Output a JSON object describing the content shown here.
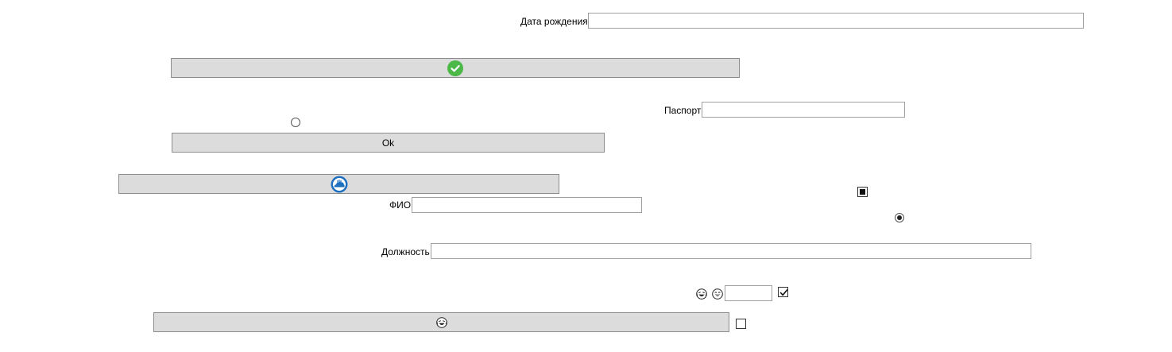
{
  "form": {
    "birth_date": {
      "label": "Дата рождения",
      "value": ""
    },
    "passport": {
      "label": "Паспорт",
      "value": ""
    },
    "full_name": {
      "label": "ФИО",
      "value": ""
    },
    "position": {
      "label": "Должность",
      "value": ""
    },
    "small_field": {
      "value": ""
    }
  },
  "buttons": {
    "confirm": {
      "label": "",
      "icon": "green-checkmark-icon",
      "color": "#4cb848"
    },
    "ok": {
      "label": "Ok"
    },
    "cloud": {
      "label": "",
      "icon": "blue-cloud-badge-icon",
      "color": "#1e6fc0"
    },
    "emoji": {
      "label": "",
      "icon": "laughing-emoji-icon"
    }
  },
  "controls": {
    "radio_1": {
      "checked": false
    },
    "radio_2": {
      "checked": true
    },
    "checkbox_indeterminate": {
      "state": "indeterminate"
    },
    "checkbox_checked": {
      "state": "checked"
    },
    "checkbox_unchecked": {
      "state": "unchecked"
    }
  },
  "icons": {
    "emoji_1": "laughing-emoji-icon",
    "emoji_2": "grinning-emoji-icon"
  },
  "colors": {
    "button_bg": "#dcdcdc",
    "button_border": "#8c8c8c",
    "field_border": "#a0a0a0",
    "check_green": "#4cb848",
    "cloud_blue": "#1e6fc0"
  }
}
